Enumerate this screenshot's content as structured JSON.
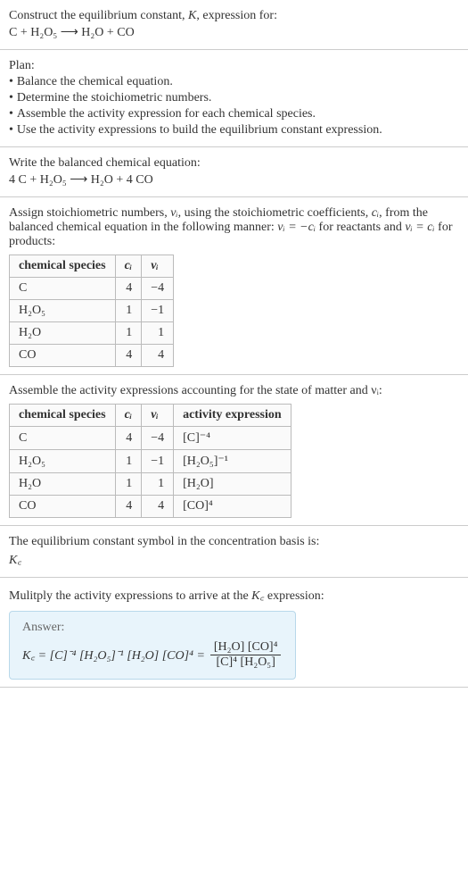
{
  "title": {
    "t1": "Construct the equilibrium constant, ",
    "K": "K",
    "t2": ", expression for:"
  },
  "unbalanced": "C + H₂O₅  ⟶  H₂O + CO",
  "plan": {
    "header": "Plan:",
    "b1": "Balance the chemical equation.",
    "b2": "Determine the stoichiometric numbers.",
    "b3": "Assemble the activity expression for each chemical species.",
    "b4": "Use the activity expressions to build the equilibrium constant expression."
  },
  "balanced": {
    "intro": "Write the balanced chemical equation:",
    "eq": "4 C + H₂O₅  ⟶  H₂O + 4 CO"
  },
  "assign": {
    "text1": "Assign stoichiometric numbers, ",
    "nu": "νᵢ",
    "text2": ", using the stoichiometric coefficients, ",
    "ci": "cᵢ",
    "text3": ", from the balanced chemical equation in the following manner: ",
    "rel_react": "νᵢ = −cᵢ",
    "text4": " for reactants and ",
    "rel_prod": "νᵢ = cᵢ",
    "text5": " for products:"
  },
  "table1": {
    "headers": [
      "chemical species",
      "cᵢ",
      "νᵢ"
    ],
    "rows": [
      [
        "C",
        "4",
        "−4"
      ],
      [
        "H₂O₅",
        "1",
        "−1"
      ],
      [
        "H₂O",
        "1",
        "1"
      ],
      [
        "CO",
        "4",
        "4"
      ]
    ]
  },
  "activity_intro": "Assemble the activity expressions accounting for the state of matter and νᵢ:",
  "table2": {
    "headers": [
      "chemical species",
      "cᵢ",
      "νᵢ",
      "activity expression"
    ],
    "rows": [
      [
        "C",
        "4",
        "−4",
        "[C]⁻⁴"
      ],
      [
        "H₂O₅",
        "1",
        "−1",
        "[H₂O₅]⁻¹"
      ],
      [
        "H₂O",
        "1",
        "1",
        "[H₂O]"
      ],
      [
        "CO",
        "4",
        "4",
        "[CO]⁴"
      ]
    ]
  },
  "kc_symbol": {
    "intro": "The equilibrium constant symbol in the concentration basis is:",
    "sym": "K꜀"
  },
  "multiply": {
    "intro1": "Mulitply the activity expressions to arrive at the ",
    "kc": "K꜀",
    "intro2": " expression:"
  },
  "answer": {
    "label": "Answer:",
    "lhs": "K꜀ = [C]⁻⁴ [H₂O₅]⁻¹ [H₂O] [CO]⁴ =",
    "num": "[H₂O] [CO]⁴",
    "den": "[C]⁴ [H₂O₅]"
  },
  "chart_data": {
    "type": "table",
    "tables": [
      {
        "title": "Stoichiometric numbers",
        "headers": [
          "chemical species",
          "c_i",
          "nu_i"
        ],
        "rows": [
          {
            "species": "C",
            "c_i": 4,
            "nu_i": -4
          },
          {
            "species": "H2O5",
            "c_i": 1,
            "nu_i": -1
          },
          {
            "species": "H2O",
            "c_i": 1,
            "nu_i": 1
          },
          {
            "species": "CO",
            "c_i": 4,
            "nu_i": 4
          }
        ]
      },
      {
        "title": "Activity expressions",
        "headers": [
          "chemical species",
          "c_i",
          "nu_i",
          "activity expression"
        ],
        "rows": [
          {
            "species": "C",
            "c_i": 4,
            "nu_i": -4,
            "activity": "[C]^-4"
          },
          {
            "species": "H2O5",
            "c_i": 1,
            "nu_i": -1,
            "activity": "[H2O5]^-1"
          },
          {
            "species": "H2O",
            "c_i": 1,
            "nu_i": 1,
            "activity": "[H2O]"
          },
          {
            "species": "CO",
            "c_i": 4,
            "nu_i": 4,
            "activity": "[CO]^4"
          }
        ]
      }
    ],
    "equilibrium_constant": "K_c = ([H2O][CO]^4) / ([C]^4 [H2O5])"
  }
}
